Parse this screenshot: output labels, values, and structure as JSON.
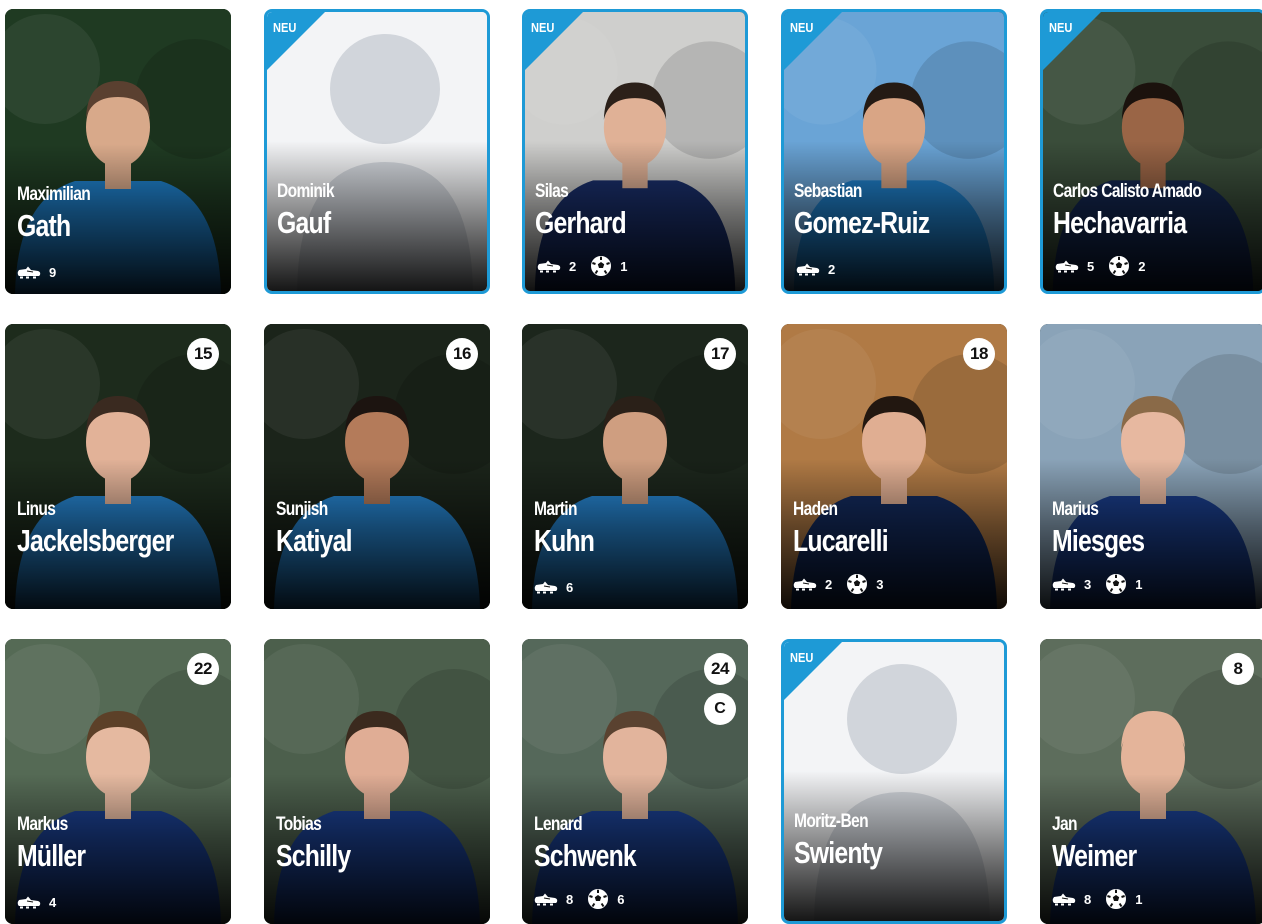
{
  "players": [
    {
      "first": "Maximilian",
      "last": "Gath",
      "number": "",
      "captain": "",
      "is_new": false,
      "boots": "9",
      "goals": "",
      "new_label": "",
      "bg": "#1f3a22",
      "jersey": "#1f7fc9",
      "skin": "#d8a98a",
      "hair": "#5a4030"
    },
    {
      "first": "Dominik",
      "last": "Gauf",
      "number": "",
      "captain": "",
      "is_new": true,
      "boots": "",
      "goals": "",
      "new_label": "NEU",
      "placeholder": true
    },
    {
      "first": "Silas",
      "last": "Gerhard",
      "number": "",
      "captain": "",
      "is_new": true,
      "boots": "2",
      "goals": "1",
      "new_label": "NEU",
      "bg": "#cfcfcd",
      "jersey": "#1a2f6b",
      "skin": "#e0b196",
      "hair": "#2b2019"
    },
    {
      "first": "Sebastian",
      "last": "Gomez-Ruiz",
      "number": "",
      "captain": "",
      "is_new": true,
      "boots": "2",
      "goals": "",
      "new_label": "NEU",
      "bg": "#6aa4d6",
      "jersey": "#1f7fc9",
      "skin": "#d9a585",
      "hair": "#241a14"
    },
    {
      "first": "Carlos Calisto Amado",
      "last": "Hechavarria",
      "number": "",
      "captain": "",
      "is_new": true,
      "boots": "5",
      "goals": "2",
      "new_label": "NEU",
      "bg": "#3a4d3a",
      "jersey": "#13264f",
      "skin": "#9a6546",
      "hair": "#1b120d"
    },
    {
      "first": "Linus",
      "last": "Jackelsberger",
      "number": "15",
      "captain": "",
      "is_new": false,
      "boots": "",
      "goals": "",
      "new_label": "",
      "bg": "#1d2b1c",
      "jersey": "#2684cf",
      "skin": "#e2b298",
      "hair": "#3a2a20"
    },
    {
      "first": "Sunjish",
      "last": "Katiyal",
      "number": "16",
      "captain": "",
      "is_new": false,
      "boots": "",
      "goals": "",
      "new_label": "",
      "bg": "#1b241a",
      "jersey": "#2684cf",
      "skin": "#b47b5a",
      "hair": "#1c1410"
    },
    {
      "first": "Martin",
      "last": "Kuhn",
      "number": "17",
      "captain": "",
      "is_new": false,
      "boots": "6",
      "goals": "",
      "new_label": "",
      "bg": "#1c261c",
      "jersey": "#2684cf",
      "skin": "#cf9e80",
      "hair": "#2a2018"
    },
    {
      "first": "Haden",
      "last": "Lucarelli",
      "number": "18",
      "captain": "",
      "is_new": false,
      "boots": "2",
      "goals": "3",
      "new_label": "",
      "bg": "#b07a45",
      "jersey": "#132a5c",
      "skin": "#e0ae92",
      "hair": "#221710"
    },
    {
      "first": "Marius",
      "last": "Miesges",
      "number": "",
      "captain": "",
      "is_new": false,
      "boots": "3",
      "goals": "1",
      "new_label": "",
      "bg": "#8aa3b8",
      "jersey": "#1a3d8a",
      "skin": "#e7b8a0",
      "hair": "#8a6a48"
    },
    {
      "first": "Markus",
      "last": "Müller",
      "number": "22",
      "captain": "",
      "is_new": false,
      "boots": "4",
      "goals": "",
      "new_label": "",
      "bg": "#556a55",
      "jersey": "#1a3d8a",
      "skin": "#e5b9a0",
      "hair": "#5c4028"
    },
    {
      "first": "Tobias",
      "last": "Schilly",
      "number": "",
      "captain": "",
      "is_new": false,
      "boots": "",
      "goals": "",
      "new_label": "",
      "bg": "#4c5f4c",
      "jersey": "#1a3d8a",
      "skin": "#e0ad95",
      "hair": "#3b2a1e"
    },
    {
      "first": "Lenard",
      "last": "Schwenk",
      "number": "24",
      "captain": "C",
      "is_new": false,
      "boots": "8",
      "goals": "6",
      "new_label": "",
      "bg": "#55685a",
      "jersey": "#1a3d8a",
      "skin": "#e2b49c",
      "hair": "#5a4230"
    },
    {
      "first": "Moritz-Ben",
      "last": "Swienty",
      "number": "",
      "captain": "",
      "is_new": true,
      "boots": "",
      "goals": "",
      "new_label": "NEU",
      "placeholder": true
    },
    {
      "first": "Jan",
      "last": "Weimer",
      "number": "8",
      "captain": "",
      "is_new": false,
      "boots": "8",
      "goals": "1",
      "new_label": "",
      "bg": "#5d6d5c",
      "jersey": "#1a3d8a",
      "skin": "#e4b49a",
      "hair": "#e4b49a"
    }
  ],
  "icons": {
    "boot": "football-boot-icon",
    "ball": "football-icon"
  },
  "colors": {
    "accent": "#1e9ad6"
  }
}
